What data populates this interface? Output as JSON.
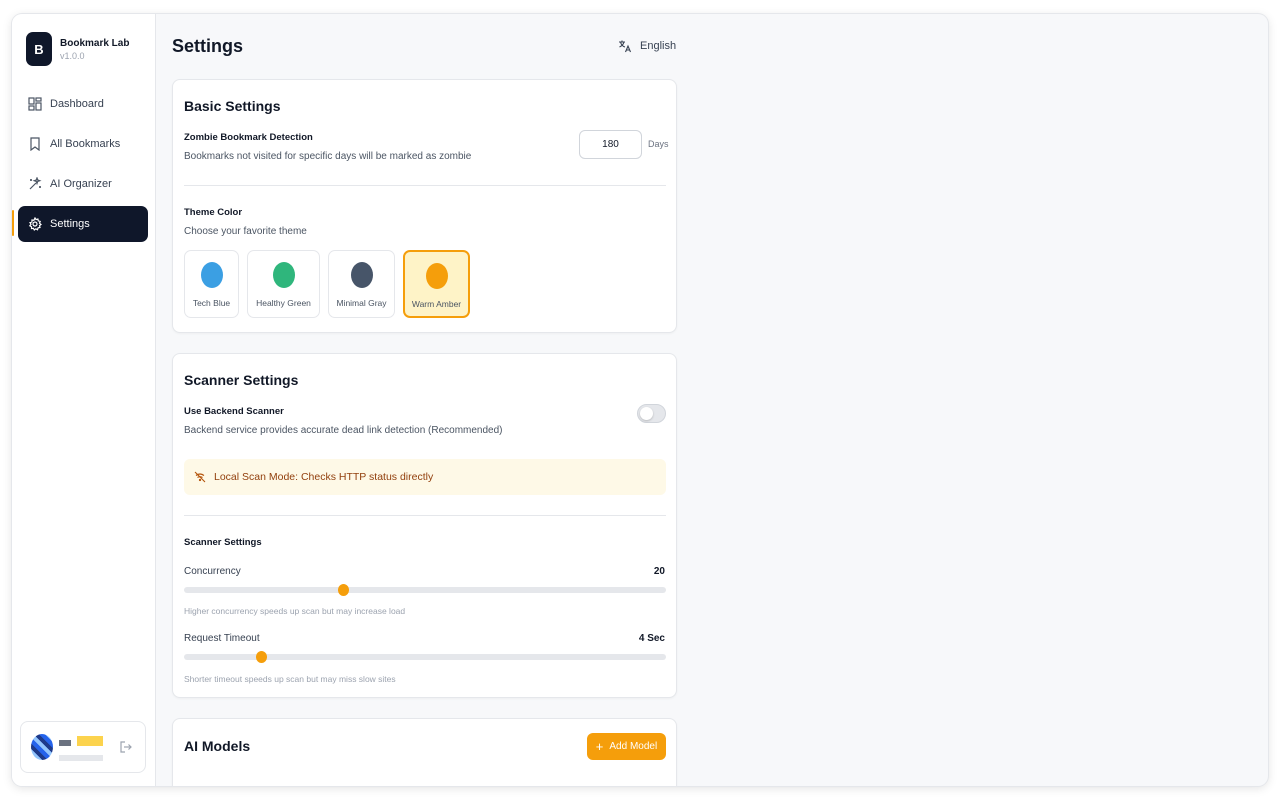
{
  "app": {
    "name": "Bookmark Lab",
    "version": "v1.0.0",
    "logo_letter": "B"
  },
  "nav": {
    "items": [
      {
        "label": "Dashboard",
        "icon": "dashboard-icon"
      },
      {
        "label": "All Bookmarks",
        "icon": "bookmark-icon"
      },
      {
        "label": "AI Organizer",
        "icon": "sparkles-icon"
      },
      {
        "label": "Settings",
        "icon": "gear-icon",
        "active": true
      }
    ]
  },
  "header": {
    "title": "Settings",
    "language": "English"
  },
  "basic": {
    "title": "Basic Settings",
    "zombie_label": "Zombie Bookmark Detection",
    "zombie_desc": "Bookmarks not visited for specific days will be marked as zombie",
    "zombie_days": "180",
    "zombie_unit": "Days",
    "theme_label": "Theme Color",
    "theme_desc": "Choose your favorite theme",
    "themes": [
      {
        "name": "Tech Blue",
        "color": "#3b9fe3"
      },
      {
        "name": "Healthy Green",
        "color": "#2fb67c"
      },
      {
        "name": "Minimal Gray",
        "color": "#475569"
      },
      {
        "name": "Warm Amber",
        "color": "#f59e0b",
        "selected": true
      }
    ]
  },
  "scanner": {
    "title": "Scanner Settings",
    "backend_label": "Use Backend Scanner",
    "backend_desc": "Backend service provides accurate dead link detection (Recommended)",
    "backend_enabled": false,
    "banner": "Local Scan Mode: Checks HTTP status directly",
    "sub_title": "Scanner Settings",
    "concurrency_label": "Concurrency",
    "concurrency_value": "20",
    "concurrency_fraction": 0.33,
    "concurrency_hint": "Higher concurrency speeds up scan but may increase load",
    "timeout_label": "Request Timeout",
    "timeout_value": "4 Sec",
    "timeout_fraction": 0.16,
    "timeout_hint": "Shorter timeout speeds up scan but may miss slow sites"
  },
  "ai_models": {
    "title": "AI Models",
    "add_label": "Add Model"
  },
  "colors": {
    "accent": "#f59e0b",
    "sidebar_active": "#0f172a"
  }
}
